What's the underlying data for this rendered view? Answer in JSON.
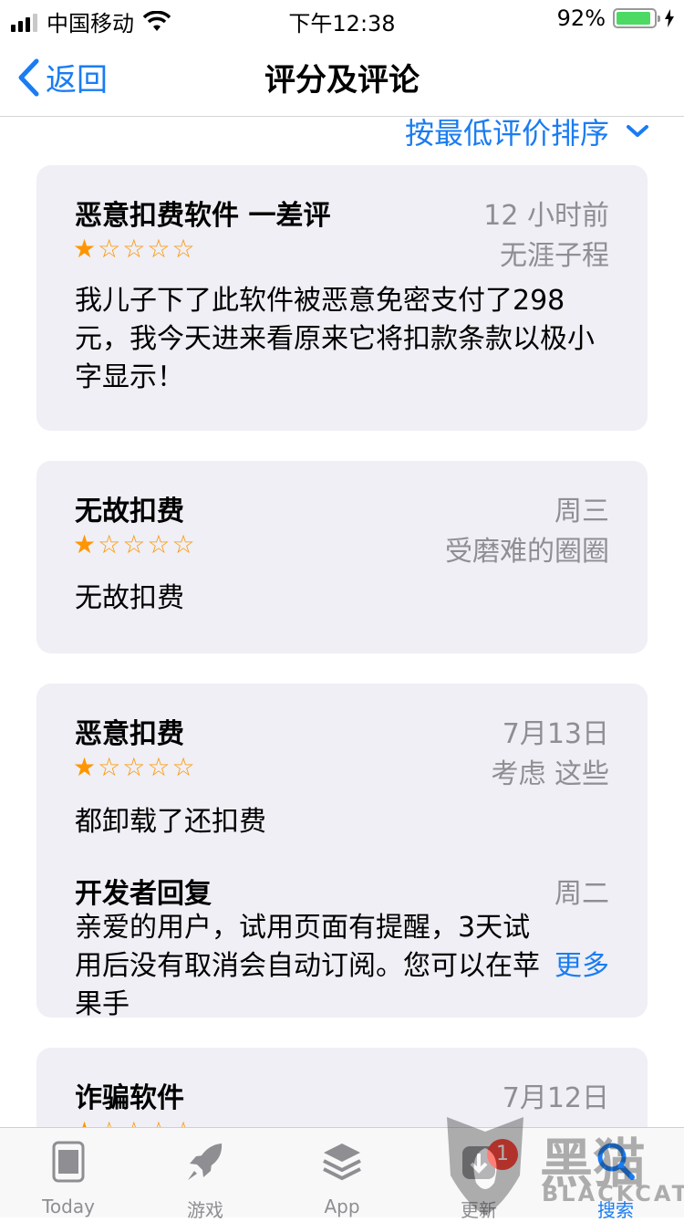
{
  "status_bar": {
    "carrier": "中国移动",
    "time": "下午12:38",
    "battery": "92%",
    "battery_level": 0.92
  },
  "nav": {
    "back_label": "返回",
    "title": "评分及评论"
  },
  "sort": {
    "label": "按最低评价排序"
  },
  "reviews": [
    {
      "title": "恶意扣费软件 一差评",
      "date": "12 小时前",
      "author": "无涯子程",
      "rating": 1,
      "max_rating": 5,
      "body": "我儿子下了此软件被恶意免密支付了298元，我今天进来看原来它将扣款条款以极小字显示！"
    },
    {
      "title": "无故扣费",
      "date": "周三",
      "author": "受磨难的圈圈",
      "rating": 1,
      "max_rating": 5,
      "body": "无故扣费"
    },
    {
      "title": "恶意扣费",
      "date": "7月13日",
      "author": "考虑 这些",
      "rating": 1,
      "max_rating": 5,
      "body": "都卸载了还扣费",
      "reply": {
        "title": "开发者回复",
        "date": "周二",
        "body": "亲爱的用户，试用页面有提醒，3天试用后没有取消会自动订阅。您可以在苹果手",
        "more": "更多"
      }
    },
    {
      "title": "诈骗软件",
      "date": "7月12日",
      "author": "",
      "rating": 1,
      "max_rating": 5
    }
  ],
  "tabbar": {
    "items": [
      {
        "label": "Today",
        "icon": "today-icon"
      },
      {
        "label": "游戏",
        "icon": "rocket-icon"
      },
      {
        "label": "App",
        "icon": "layers-icon"
      },
      {
        "label": "更新",
        "icon": "download-icon",
        "badge": "1"
      },
      {
        "label": "搜索",
        "icon": "search-icon",
        "active": true
      }
    ]
  },
  "watermark": {
    "text": "黑猫",
    "sub": "BLACKCAT"
  },
  "colors": {
    "accent": "#1a7cf2",
    "star": "#ff9500",
    "card_bg": "#efeff5",
    "badge": "#ff3b30"
  }
}
